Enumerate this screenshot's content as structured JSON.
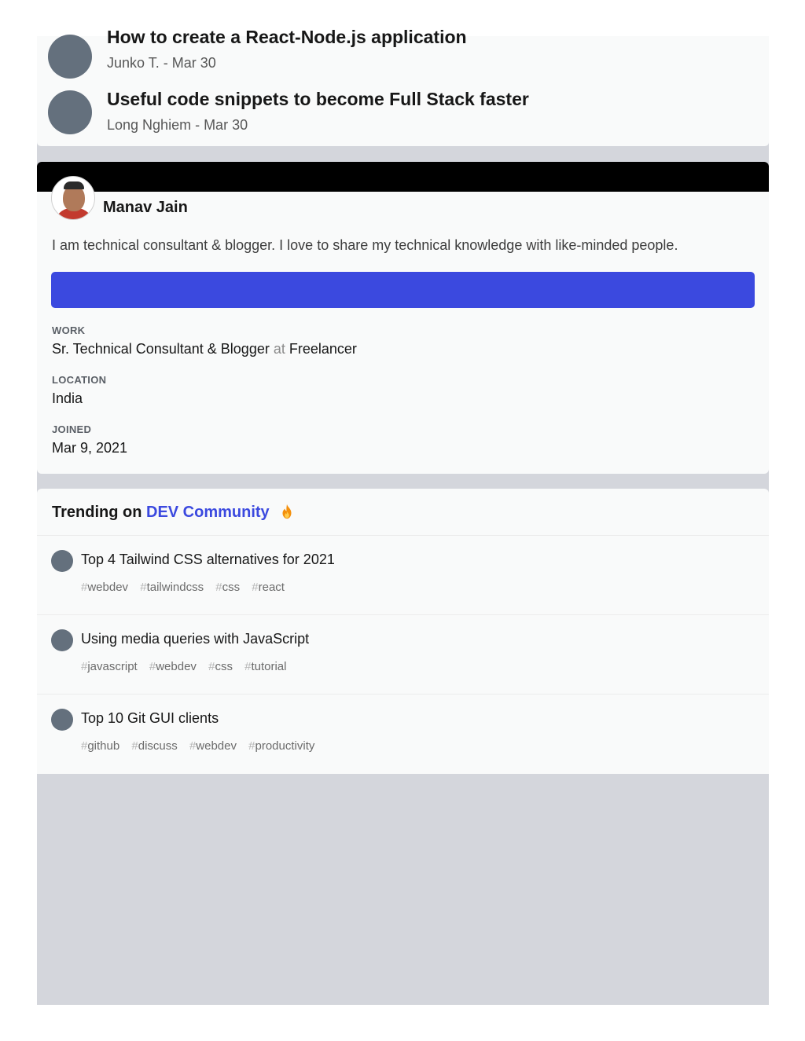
{
  "more_posts": [
    {
      "title": "How to create a React-Node.js application",
      "meta": "Junko T. - Mar 30"
    },
    {
      "title": "Useful code snippets to become Full Stack faster",
      "meta": "Long Nghiem - Mar 30"
    }
  ],
  "profile": {
    "name": "Manav Jain",
    "bio": "I am technical consultant & blogger. I love to share my technical knowledge with like-minded people.",
    "follow_label": "",
    "work_label": "WORK",
    "work_title": "Sr. Technical Consultant & Blogger",
    "work_at": "at",
    "work_company": "Freelancer",
    "location_label": "LOCATION",
    "location": "India",
    "joined_label": "JOINED",
    "joined": "Mar 9, 2021",
    "accent_color": "#3b49df",
    "banner_color": "#000000"
  },
  "trending": {
    "prefix": "Trending on",
    "community": "DEV Community",
    "icon": "fire-icon",
    "items": [
      {
        "title": "Top 4 Tailwind CSS alternatives for 2021",
        "tags": [
          "webdev",
          "tailwindcss",
          "css",
          "react"
        ]
      },
      {
        "title": "Using media queries with JavaScript",
        "tags": [
          "javascript",
          "webdev",
          "css",
          "tutorial"
        ]
      },
      {
        "title": "Top 10 Git GUI clients",
        "tags": [
          "github",
          "discuss",
          "webdev",
          "productivity"
        ]
      }
    ]
  },
  "tag_prefix": "#"
}
